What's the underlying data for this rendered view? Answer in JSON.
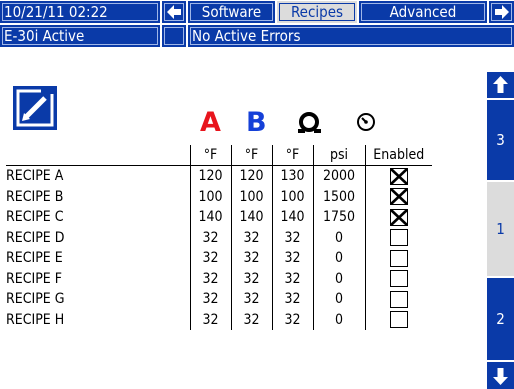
{
  "topbar": {
    "datetime": "10/21/11 02:22",
    "tabs": [
      {
        "label": "Software",
        "selected": false
      },
      {
        "label": "Recipes",
        "selected": true
      },
      {
        "label": "Advanced",
        "selected": false
      }
    ]
  },
  "statusbar": {
    "mode": "E-30i Active",
    "errors": "No Active Errors"
  },
  "columns": {
    "a_label": "A",
    "b_label": "B",
    "units": [
      "°F",
      "°F",
      "°F",
      "psi"
    ],
    "enabled_header": "Enabled"
  },
  "colors": {
    "accent_blue": "#0a3aa8",
    "a_red": "#e8141c",
    "b_blue": "#1540d8",
    "selected_gray": "#dcdcdc"
  },
  "icons": {
    "edit": "edit-icon",
    "hose": "hose-icon",
    "pressure": "pressure-gauge-icon",
    "prev_screen": "arrow-left-icon",
    "next_screen": "arrow-right-icon",
    "page_up": "arrow-up-icon",
    "page_down": "arrow-down-icon",
    "checkbox_checked": "check-x-icon"
  },
  "side": {
    "pages": [
      "3",
      "1",
      "2"
    ],
    "selected_index": 1
  },
  "recipes": [
    {
      "name": "RECIPE A",
      "a": "120",
      "b": "120",
      "hose": "130",
      "psi": "2000",
      "enabled": true
    },
    {
      "name": "RECIPE B",
      "a": "100",
      "b": "100",
      "hose": "100",
      "psi": "1500",
      "enabled": true
    },
    {
      "name": "RECIPE C",
      "a": "140",
      "b": "140",
      "hose": "140",
      "psi": "1750",
      "enabled": true
    },
    {
      "name": "RECIPE D",
      "a": "32",
      "b": "32",
      "hose": "32",
      "psi": "0",
      "enabled": false
    },
    {
      "name": "RECIPE E",
      "a": "32",
      "b": "32",
      "hose": "32",
      "psi": "0",
      "enabled": false
    },
    {
      "name": "RECIPE F",
      "a": "32",
      "b": "32",
      "hose": "32",
      "psi": "0",
      "enabled": false
    },
    {
      "name": "RECIPE G",
      "a": "32",
      "b": "32",
      "hose": "32",
      "psi": "0",
      "enabled": false
    },
    {
      "name": "RECIPE H",
      "a": "32",
      "b": "32",
      "hose": "32",
      "psi": "0",
      "enabled": false
    }
  ]
}
